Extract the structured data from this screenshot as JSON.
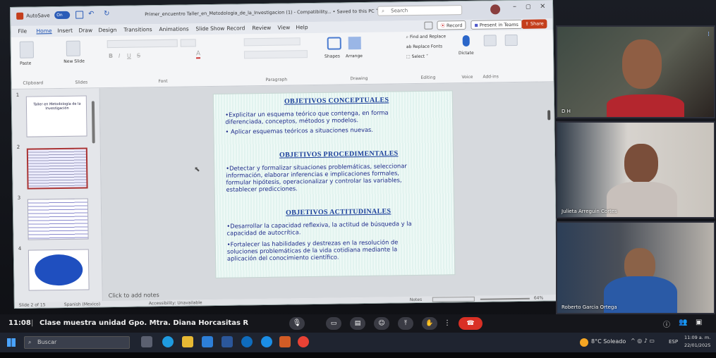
{
  "ppt": {
    "autosave": "AutoSave",
    "toggle": "On",
    "doc_title": "Primer_encuentro Taller_en_Metodologia_de_la_Investigacion (1) - Compatibility... • Saved to this PC ˅",
    "search_placeholder": "Search",
    "tabs": [
      "File",
      "Home",
      "Insert",
      "Draw",
      "Design",
      "Transitions",
      "Animations",
      "Slide Show",
      "Record",
      "Review",
      "View",
      "Help"
    ],
    "record_btn": "Record",
    "present_btn": "Present in Teams",
    "share_btn": "Share",
    "ribbon": {
      "paste": "Paste",
      "new_slide": "New Slide",
      "clipboard": "Clipboard",
      "slides": "Slides",
      "font": "Font",
      "paragraph": "Paragraph",
      "shapes": "Shapes",
      "arrange": "Arrange",
      "drawing": "Drawing",
      "find_replace": "Find and Replace",
      "replace_fonts": "Replace Fonts",
      "select": "Select ˅",
      "editing": "Editing",
      "dictate": "Dictate",
      "voice": "Voice",
      "addins": "Add-ins"
    },
    "thumb_numbers": [
      "1",
      "2",
      "3",
      "4"
    ],
    "thumb1_text": "Taller en Metodología de la Investigación",
    "slide": {
      "h1": "OBJETIVOS CONCEPTUALES",
      "b1": "•Explicitar un esquema teórico que contenga, en forma diferenciada, conceptos, métodos y modelos.",
      "b2": "• Aplicar esquemas teóricos a situaciones nuevas.",
      "h2": "OBJETIVOS PROCEDIMENTALES",
      "b3": "•Detectar y formalizar situaciones problemáticas, seleccionar información, elaborar inferencias e implicaciones formales, formular hipótesis, operacionalizar y controlar las variables, establecer predicciones.",
      "h3": "OBJETIVOS ACTITUDINALES",
      "b4": "•Desarrollar la capacidad reflexiva, la actitud de búsqueda y la capacidad de autocrítica.",
      "b5": "•Fortalecer las habilidades y destrezas en la resolución de soluciones problemáticas de la vida cotidiana mediante la aplicación del conocimiento científico."
    },
    "notes": "Click to add notes",
    "status_slide": "Slide 2 of 15",
    "status_lang": "Spanish (Mexico)",
    "status_access": "Accessibility: Unavailable",
    "status_notes": "Notes",
    "status_zoom": "64%"
  },
  "participants": [
    {
      "name": "D H"
    },
    {
      "name": "Julieta Arreguin Cortes"
    },
    {
      "name": "Roberto Garcia Ortega"
    }
  ],
  "meeting": {
    "time": "11:08",
    "title": "Clase muestra unidad Gpo. Mtra. Diana Horcasitas R"
  },
  "taskbar": {
    "search": "Buscar",
    "weather": "8°C Soleado",
    "lang": "ESP",
    "clock_time": "11:09 a. m.",
    "clock_date": "22/01/2025"
  }
}
